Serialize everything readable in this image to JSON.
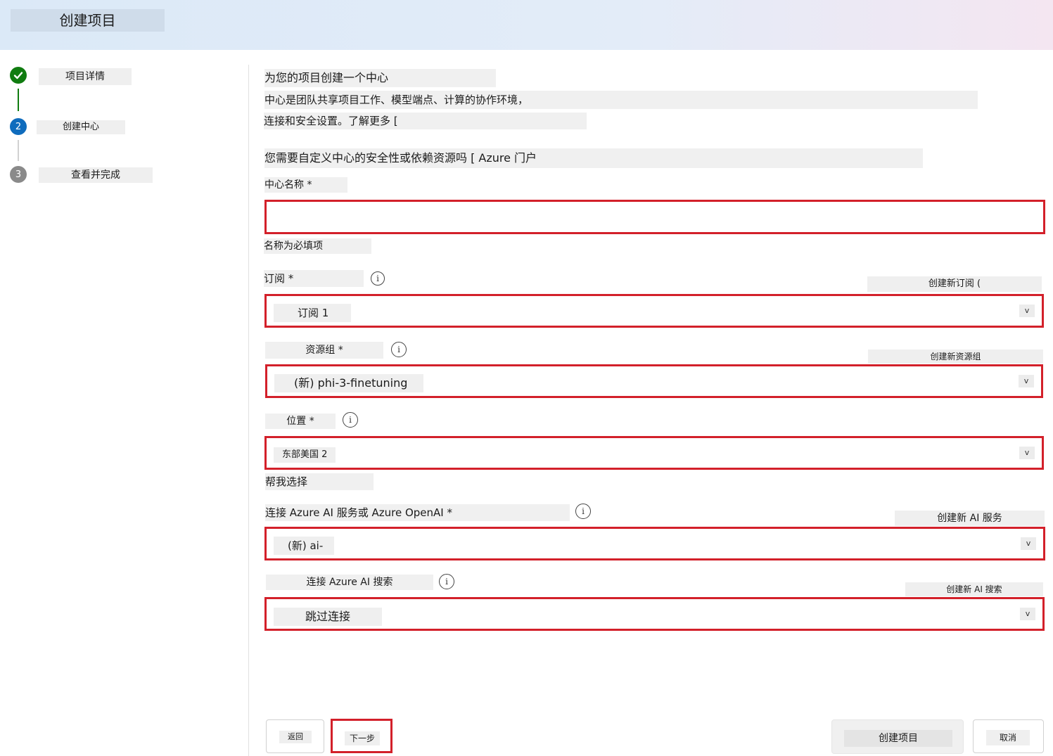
{
  "header": {
    "title": "创建项目"
  },
  "steps": [
    {
      "label": "项目详情",
      "number": ""
    },
    {
      "label": "创建中心",
      "number": "2"
    },
    {
      "label": "查看并完成",
      "number": "3"
    }
  ],
  "intro": {
    "heading": "为您的项目创建一个中心",
    "line1": "中心是团队共享项目工作、模型端点、计算的协作环境，",
    "line2": "连接和安全设置。了解更多 [",
    "customize": "您需要自定义中心的安全性或依赖资源吗 [ Azure 门户"
  },
  "hub_name": {
    "label": "中心名称 *",
    "value": "",
    "error": "名称为必填项"
  },
  "subscription": {
    "label": "订阅 *",
    "value": "订阅 1",
    "create_link": "创建新订阅 ("
  },
  "resource_group": {
    "label": "资源组 *",
    "value": "(新) phi-3-finetuning",
    "create_link": "创建新资源组"
  },
  "location": {
    "label": "位置 *",
    "value": "东部美国 2",
    "help_link": "帮我选择"
  },
  "ai_services": {
    "label": "连接 Azure AI 服务或 Azure OpenAI *",
    "value": "(新) ai-",
    "create_link": "创建新 AI 服务"
  },
  "ai_search": {
    "label": "连接 Azure AI 搜索",
    "value": "跳过连接",
    "create_link": "创建新 AI 搜索"
  },
  "footer": {
    "back": "返回",
    "next": "下一步",
    "create": "创建项目",
    "cancel": "取消"
  },
  "colors": {
    "highlight": "#d3202a",
    "done": "#107c10",
    "active": "#0f6cbd"
  }
}
